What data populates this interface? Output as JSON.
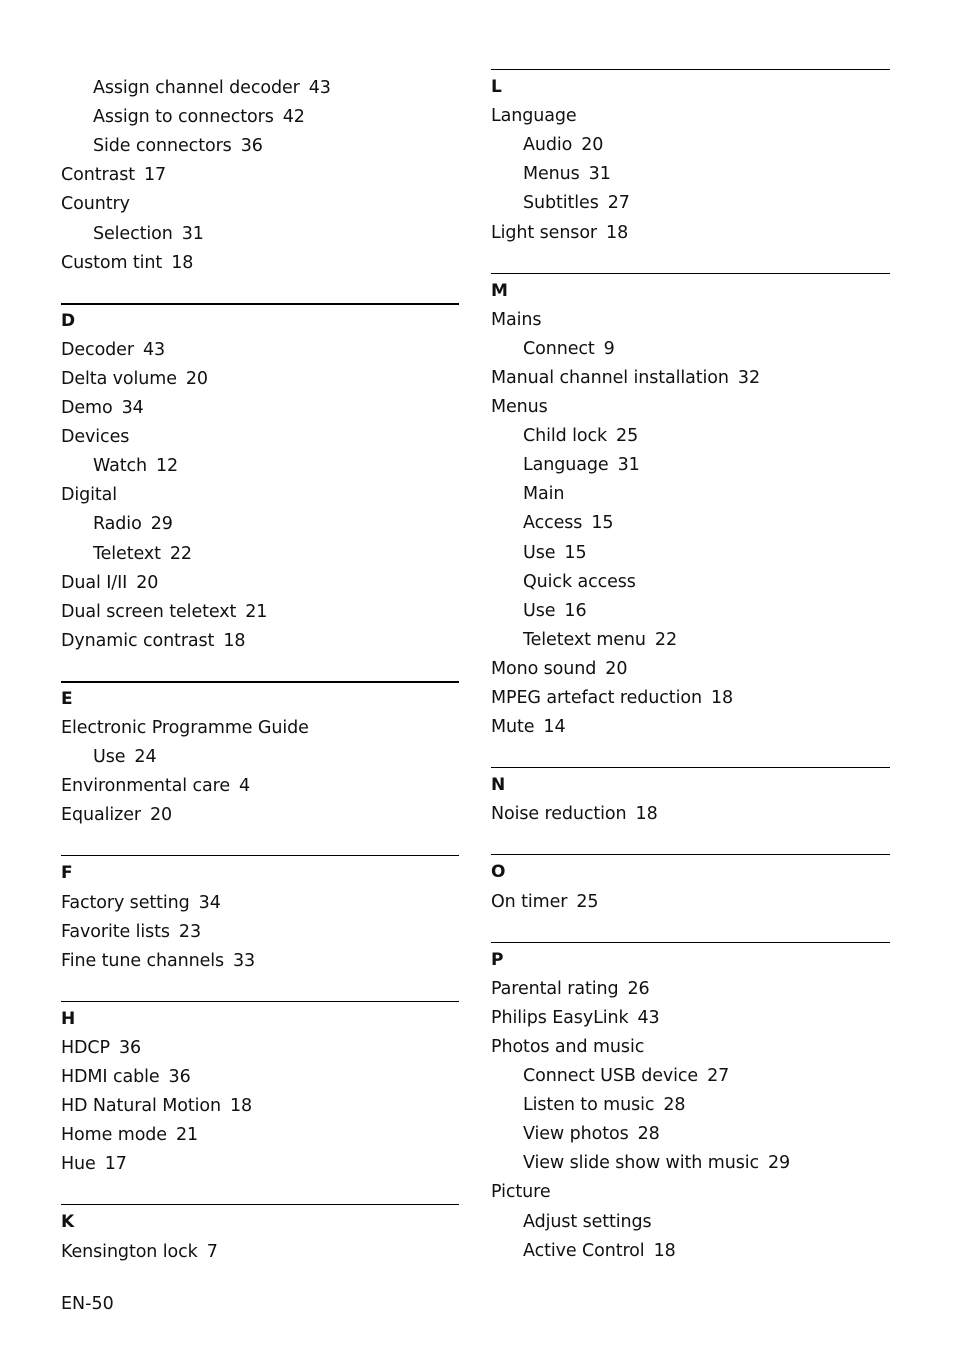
{
  "page_number": "EN-50",
  "columns": [
    {
      "id": "left",
      "sections": [
        {
          "letter": "",
          "rule": "none",
          "entries": [
            {
              "level": 2,
              "term": "Assign channel decoder",
              "page": "43"
            },
            {
              "level": 2,
              "term": "Assign to connectors",
              "page": "42"
            },
            {
              "level": 2,
              "term": "Side connectors",
              "page": "36"
            },
            {
              "level": 1,
              "term": "Contrast",
              "page": "17"
            },
            {
              "level": 1,
              "term": "Country",
              "page": ""
            },
            {
              "level": 2,
              "term": "Selection",
              "page": "31"
            },
            {
              "level": 1,
              "term": "Custom tint",
              "page": "18"
            }
          ]
        },
        {
          "letter": "D",
          "rule": "thick",
          "entries": [
            {
              "level": 1,
              "term": "Decoder",
              "page": "43"
            },
            {
              "level": 1,
              "term": "Delta volume",
              "page": "20"
            },
            {
              "level": 1,
              "term": "Demo",
              "page": "34"
            },
            {
              "level": 1,
              "term": "Devices",
              "page": ""
            },
            {
              "level": 2,
              "term": "Watch",
              "page": "12"
            },
            {
              "level": 1,
              "term": "Digital",
              "page": ""
            },
            {
              "level": 2,
              "term": "Radio",
              "page": "29"
            },
            {
              "level": 2,
              "term": "Teletext",
              "page": "22"
            },
            {
              "level": 1,
              "term": "Dual I/II",
              "page": "20"
            },
            {
              "level": 1,
              "term": "Dual screen teletext",
              "page": "21"
            },
            {
              "level": 1,
              "term": "Dynamic contrast",
              "page": "18"
            }
          ]
        },
        {
          "letter": "E",
          "rule": "thick",
          "entries": [
            {
              "level": 1,
              "term": "Electronic Programme Guide",
              "page": ""
            },
            {
              "level": 2,
              "term": "Use",
              "page": "24"
            },
            {
              "level": 1,
              "term": "Environmental care",
              "page": "4"
            },
            {
              "level": 1,
              "term": "Equalizer",
              "page": "20"
            }
          ]
        },
        {
          "letter": "F",
          "rule": "thin",
          "entries": [
            {
              "level": 1,
              "term": "Factory setting",
              "page": "34"
            },
            {
              "level": 1,
              "term": "Favorite lists",
              "page": "23"
            },
            {
              "level": 1,
              "term": "Fine tune channels",
              "page": "33"
            }
          ]
        },
        {
          "letter": "H",
          "rule": "thin",
          "entries": [
            {
              "level": 1,
              "term": "HDCP",
              "page": "36"
            },
            {
              "level": 1,
              "term": "HDMI cable",
              "page": "36"
            },
            {
              "level": 1,
              "term": "HD Natural Motion",
              "page": "18"
            },
            {
              "level": 1,
              "term": "Home mode",
              "page": "21"
            },
            {
              "level": 1,
              "term": "Hue",
              "page": "17"
            }
          ]
        },
        {
          "letter": "K",
          "rule": "thin",
          "entries": [
            {
              "level": 1,
              "term": "Kensington lock",
              "page": "7"
            }
          ]
        }
      ]
    },
    {
      "id": "right",
      "sections": [
        {
          "letter": "L",
          "rule": "thin",
          "entries": [
            {
              "level": 1,
              "term": "Language",
              "page": ""
            },
            {
              "level": 2,
              "term": "Audio",
              "page": "20"
            },
            {
              "level": 2,
              "term": "Menus",
              "page": "31"
            },
            {
              "level": 2,
              "term": "Subtitles",
              "page": "27"
            },
            {
              "level": 1,
              "term": "Light sensor",
              "page": "18"
            }
          ]
        },
        {
          "letter": "M",
          "rule": "thin",
          "entries": [
            {
              "level": 1,
              "term": "Mains",
              "page": ""
            },
            {
              "level": 2,
              "term": "Connect",
              "page": "9"
            },
            {
              "level": 1,
              "term": "Manual channel installation",
              "page": "32"
            },
            {
              "level": 1,
              "term": "Menus",
              "page": ""
            },
            {
              "level": 2,
              "term": "Child lock",
              "page": "25"
            },
            {
              "level": 2,
              "term": "Language",
              "page": "31"
            },
            {
              "level": 2,
              "term": "Main",
              "page": ""
            },
            {
              "level": 2,
              "term": "Access",
              "page": "15"
            },
            {
              "level": 2,
              "term": "Use",
              "page": "15"
            },
            {
              "level": 2,
              "term": "Quick access",
              "page": ""
            },
            {
              "level": 2,
              "term": "Use",
              "page": "16"
            },
            {
              "level": 2,
              "term": "Teletext menu",
              "page": "22"
            },
            {
              "level": 1,
              "term": "Mono sound",
              "page": "20"
            },
            {
              "level": 1,
              "term": "MPEG artefact reduction",
              "page": "18"
            },
            {
              "level": 1,
              "term": "Mute",
              "page": "14"
            }
          ]
        },
        {
          "letter": "N",
          "rule": "thin",
          "entries": [
            {
              "level": 1,
              "term": "Noise reduction",
              "page": "18"
            }
          ]
        },
        {
          "letter": "O",
          "rule": "thin",
          "entries": [
            {
              "level": 1,
              "term": "On timer",
              "page": "25"
            }
          ]
        },
        {
          "letter": "P",
          "rule": "thin",
          "entries": [
            {
              "level": 1,
              "term": "Parental rating",
              "page": "26"
            },
            {
              "level": 1,
              "term": "Philips EasyLink",
              "page": "43"
            },
            {
              "level": 1,
              "term": "Photos and music",
              "page": ""
            },
            {
              "level": 2,
              "term": "Connect USB device",
              "page": "27"
            },
            {
              "level": 2,
              "term": "Listen to music",
              "page": "28"
            },
            {
              "level": 2,
              "term": "View photos",
              "page": "28"
            },
            {
              "level": 2,
              "term": "View slide show with music",
              "page": "29"
            },
            {
              "level": 1,
              "term": "Picture",
              "page": ""
            },
            {
              "level": 2,
              "term": "Adjust settings",
              "page": ""
            },
            {
              "level": 2,
              "term": "Active Control",
              "page": "18"
            }
          ]
        }
      ]
    }
  ]
}
